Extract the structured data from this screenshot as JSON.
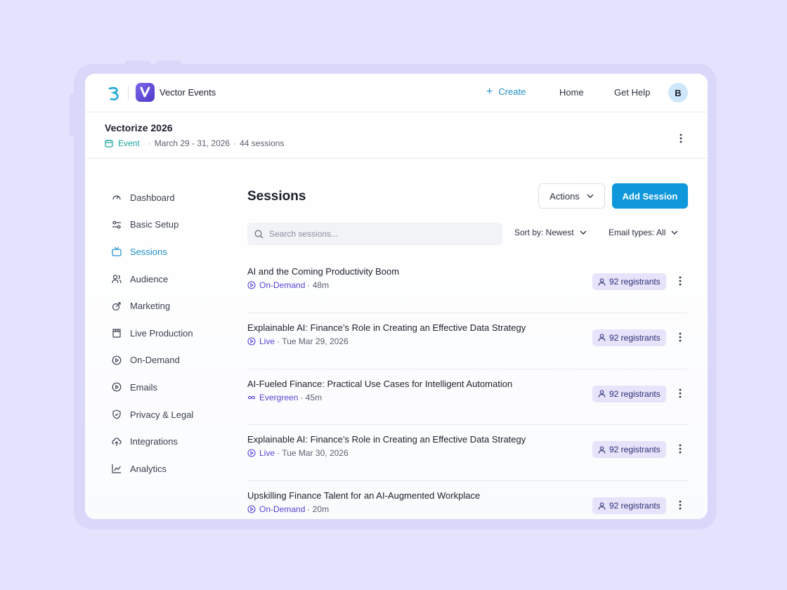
{
  "app": {
    "name": "Vector Events",
    "create_label": "Create",
    "home_label": "Home",
    "help_label": "Get Help",
    "avatar_initial": "B"
  },
  "event": {
    "title": "Vectorize 2026",
    "type": "Event",
    "dates": "March 29 - 31, 2026",
    "sessions_count": "44 sessions"
  },
  "sidebar": {
    "items": [
      {
        "label": "Dashboard",
        "icon": "gauge-icon"
      },
      {
        "label": "Basic Setup",
        "icon": "sliders-icon"
      },
      {
        "label": "Sessions",
        "icon": "tv-icon",
        "active": true
      },
      {
        "label": "Audience",
        "icon": "users-icon"
      },
      {
        "label": "Marketing",
        "icon": "megaphone-icon"
      },
      {
        "label": "Live Production",
        "icon": "clapperboard-icon"
      },
      {
        "label": "On-Demand",
        "icon": "play-circle-icon"
      },
      {
        "label": "Emails",
        "icon": "play-circle-icon"
      },
      {
        "label": "Privacy & Legal",
        "icon": "shield-icon"
      },
      {
        "label": "Integrations",
        "icon": "cloud-upload-icon"
      },
      {
        "label": "Analytics",
        "icon": "chart-line-icon"
      }
    ]
  },
  "main": {
    "title": "Sessions",
    "actions_label": "Actions",
    "add_label": "Add Session",
    "search_placeholder": "Search sessions...",
    "sort_label": "Sort by: Newest",
    "email_filter_label": "Email types: All"
  },
  "sessions": [
    {
      "title": "AI and the Coming Productivity Boom",
      "type": "On-Demand",
      "type_icon": "play-circle-icon",
      "detail": "48m",
      "registrants": "92 registrants"
    },
    {
      "title": "Explainable AI: Finance’s Role in Creating an Effective Data Strategy",
      "type": "Live",
      "type_icon": "play-circle-icon",
      "detail": "Tue Mar 29, 2026",
      "registrants": "92 registrants"
    },
    {
      "title": "AI-Fueled Finance: Practical Use Cases for Intelligent Automation",
      "type": "Evergreen",
      "type_icon": "infinity-icon",
      "detail": "45m",
      "registrants": "92 registrants"
    },
    {
      "title": "Explainable AI: Finance’s Role in Creating an Effective Data Strategy",
      "type": "Live",
      "type_icon": "play-circle-icon",
      "detail": "Tue Mar 30, 2026",
      "registrants": "92 registrants"
    },
    {
      "title": "Upskilling Finance Talent for an AI-Augmented Workplace",
      "type": "On-Demand",
      "type_icon": "play-circle-icon",
      "detail": "20m",
      "registrants": "92 registrants"
    }
  ],
  "colors": {
    "accent": "#0f97dc",
    "active_nav": "#1f8fc9",
    "session_type": "#5544d8",
    "event_type": "#1aa39c",
    "badge_bg": "#e6e3fb"
  }
}
